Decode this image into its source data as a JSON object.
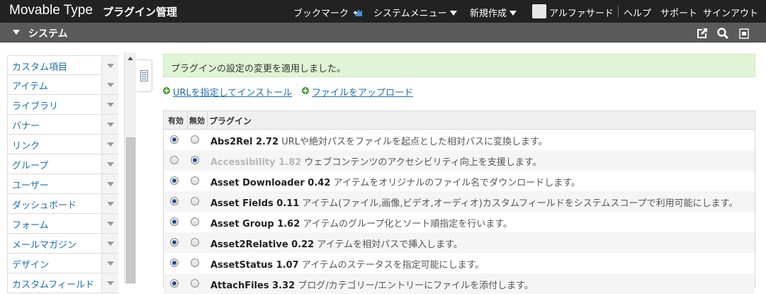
{
  "topbar": {
    "brand": "Movable Type",
    "page_title": "プラグイン管理",
    "bookmark": "ブックマーク",
    "system_menu": "システムメニュー",
    "new_create": "新規作成",
    "username": "アルファサード",
    "help": "ヘルプ",
    "support": "サポート",
    "signout": "サインアウト",
    "bg_color": "#222222"
  },
  "scope": {
    "label": "システム",
    "icons": [
      "external-link-icon",
      "search-icon",
      "trash-icon"
    ]
  },
  "sidebar": {
    "items": [
      {
        "label": "カスタム項目"
      },
      {
        "label": "アイテム"
      },
      {
        "label": "ライブラリ"
      },
      {
        "label": "バナー"
      },
      {
        "label": "リンク"
      },
      {
        "label": "グループ"
      },
      {
        "label": "ユーザー"
      },
      {
        "label": "ダッシュボード"
      },
      {
        "label": "フォーム"
      },
      {
        "label": "メールマガジン"
      },
      {
        "label": "デザイン"
      },
      {
        "label": "カスタムフィールド"
      }
    ]
  },
  "main": {
    "notice": "プラグインの設定の変更を適用しました。",
    "install_url_link": "URLを指定してインストール",
    "upload_file_link": "ファイルをアップロード",
    "table": {
      "headers": {
        "enabled": "有効",
        "disabled": "無効",
        "plugin": "プラグイン"
      },
      "rows": [
        {
          "name": "Abs2Rel 2.72",
          "desc": "URLや絶対パスをファイルを起点とした相対パスに変換します。",
          "enabled": true
        },
        {
          "name": "Accessibility 1.82",
          "desc": "ウェブコンテンツのアクセシビリティ向上を支援します。",
          "enabled": false
        },
        {
          "name": "Asset Downloader 0.42",
          "desc": "アイテムをオリジナルのファイル名でダウンロードします。",
          "enabled": true
        },
        {
          "name": "Asset Fields 0.11",
          "desc": "アイテム(ファイル,画像,ビデオ,オーディオ)カスタムフィールドをシステムスコープで利用可能にします。",
          "enabled": true
        },
        {
          "name": "Asset Group 1.62",
          "desc": "アイテムのグループ化とソート順指定を行います。",
          "enabled": true
        },
        {
          "name": "Asset2Relative 0.22",
          "desc": "アイテムを相対パスで挿入します。",
          "enabled": true
        },
        {
          "name": "AssetStatus 1.07",
          "desc": "アイテムのステータスを指定可能にします。",
          "enabled": true
        },
        {
          "name": "AttachFiles 3.32",
          "desc": "ブログ/カテゴリー/エントリーにファイルを添付します。",
          "enabled": true
        }
      ]
    }
  },
  "colors": {
    "link": "#1b6fb5",
    "notice_bg": "#dff5d4",
    "scope_bg": "#5a5a5a"
  }
}
